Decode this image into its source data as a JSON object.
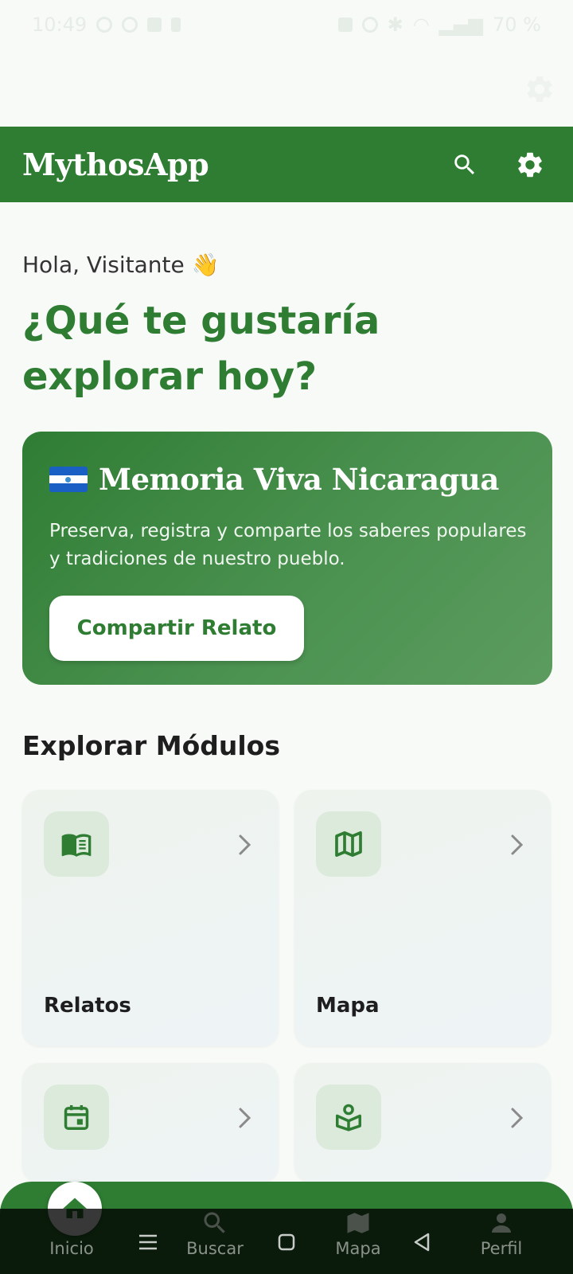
{
  "status_bar": {
    "time": "10:49",
    "battery": "70 %"
  },
  "app_bar": {
    "title": "MythosApp",
    "search_icon": "search-icon",
    "settings_icon": "gear-icon"
  },
  "greeting": "Hola, Visitante 👋",
  "headline": "¿Qué te gustaría explorar hoy?",
  "hero": {
    "title": "Memoria Viva Nicaragua",
    "description": "Preserva, registra y comparte los saberes populares y tradiciones de nuestro pueblo.",
    "button_label": "Compartir Relato"
  },
  "modules": {
    "section_title": "Explorar Módulos",
    "items": [
      {
        "label": "Relatos",
        "icon": "book-icon"
      },
      {
        "label": "Mapa",
        "icon": "map-icon"
      },
      {
        "label": "",
        "icon": "calendar-icon"
      },
      {
        "label": "",
        "icon": "reader-icon"
      }
    ]
  },
  "bottom_nav": {
    "items": [
      {
        "label": "Inicio",
        "icon": "home-icon"
      },
      {
        "label": "Buscar",
        "icon": "search-icon"
      },
      {
        "label": "Mapa",
        "icon": "map-icon"
      },
      {
        "label": "Perfil",
        "icon": "person-icon"
      }
    ]
  },
  "colors": {
    "primary": "#2e7d32",
    "background": "#f8faf8",
    "card_bg": "#eef3ee",
    "icon_box_bg": "#dceadb"
  }
}
